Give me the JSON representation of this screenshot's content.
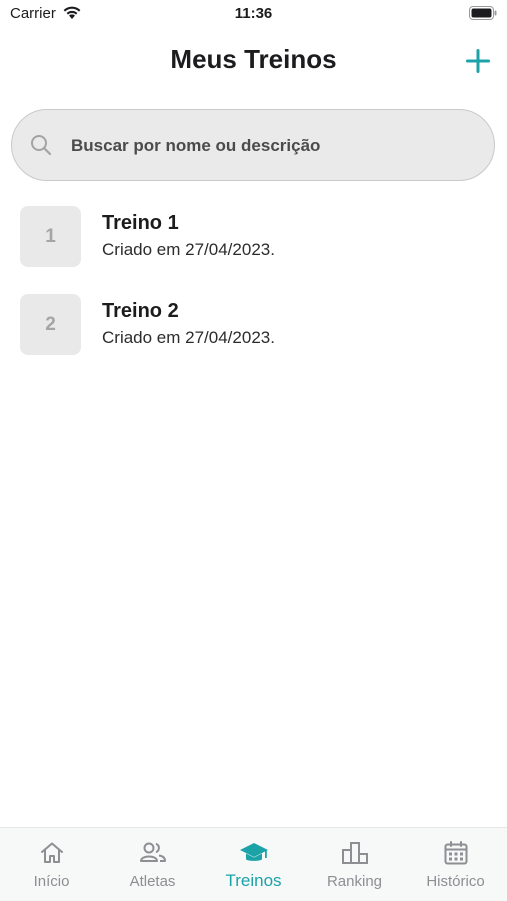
{
  "status_bar": {
    "carrier": "Carrier",
    "time": "11:36"
  },
  "header": {
    "title": "Meus Treinos",
    "add_icon": "plus-icon"
  },
  "search": {
    "placeholder": "Buscar por nome ou descrição",
    "value": ""
  },
  "items": [
    {
      "badge": "1",
      "title": "Treino 1",
      "subtitle": "Criado em 27/04/2023."
    },
    {
      "badge": "2",
      "title": "Treino 2",
      "subtitle": "Criado em 27/04/2023."
    }
  ],
  "tabs": [
    {
      "label": "Início",
      "icon": "home-icon",
      "active": false
    },
    {
      "label": "Atletas",
      "icon": "people-icon",
      "active": false
    },
    {
      "label": "Treinos",
      "icon": "graduation-cap-icon",
      "active": true
    },
    {
      "label": "Ranking",
      "icon": "podium-icon",
      "active": false
    },
    {
      "label": "Histórico",
      "icon": "calendar-icon",
      "active": false
    }
  ],
  "colors": {
    "accent": "#1ba3a8",
    "inactive": "#8e8e93",
    "badge_bg": "#e9e9ea"
  }
}
